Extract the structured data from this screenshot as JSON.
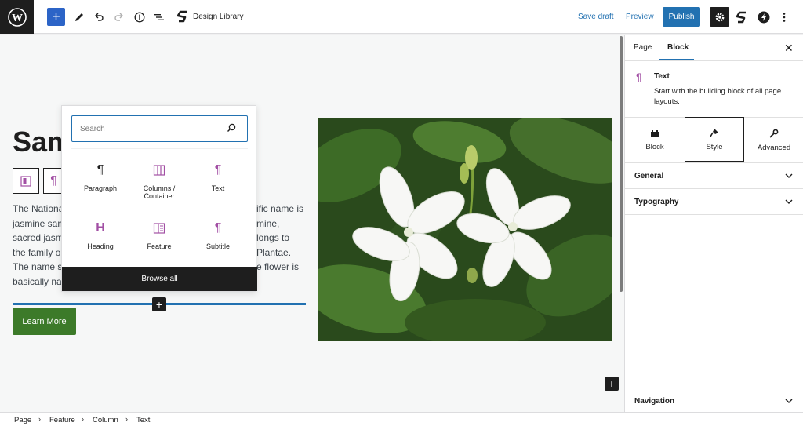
{
  "topbar": {
    "design_library_label": "Design Library",
    "save_draft_label": "Save draft",
    "preview_label": "Preview",
    "publish_label": "Publish",
    "accent": "#2271b1"
  },
  "canvas": {
    "heading": "Sam",
    "body_left": [
      "The National",
      "jasmine sam",
      "sacred jasm",
      "the family o",
      "The name s",
      "basically na"
    ],
    "body_right": [
      "ific name is",
      "mine,",
      "longs to",
      "Plantae.",
      "e flower is"
    ],
    "button_label": "Learn More",
    "button_color": "#3c7a29"
  },
  "inserter": {
    "search_placeholder": "Search",
    "blocks": [
      {
        "label": "Paragraph",
        "icon": "paragraph-icon"
      },
      {
        "label": "Columns / Container",
        "icon": "columns-icon"
      },
      {
        "label": "Text",
        "icon": "text-icon"
      },
      {
        "label": "Heading",
        "icon": "heading-icon"
      },
      {
        "label": "Feature",
        "icon": "feature-icon"
      },
      {
        "label": "Subtitle",
        "icon": "subtitle-icon"
      }
    ],
    "browse_all_label": "Browse all"
  },
  "sidebar": {
    "tabs": [
      "Page",
      "Block"
    ],
    "active_tab": "Block",
    "block_card": {
      "title": "Text",
      "description": "Start with the building block of all page layouts."
    },
    "segments": [
      "Block",
      "Style",
      "Advanced"
    ],
    "active_segment": "Style",
    "panels": [
      "General",
      "Typography"
    ],
    "bottom_panel": "Navigation"
  },
  "breadcrumb": [
    "Page",
    "Feature",
    "Column",
    "Text"
  ]
}
